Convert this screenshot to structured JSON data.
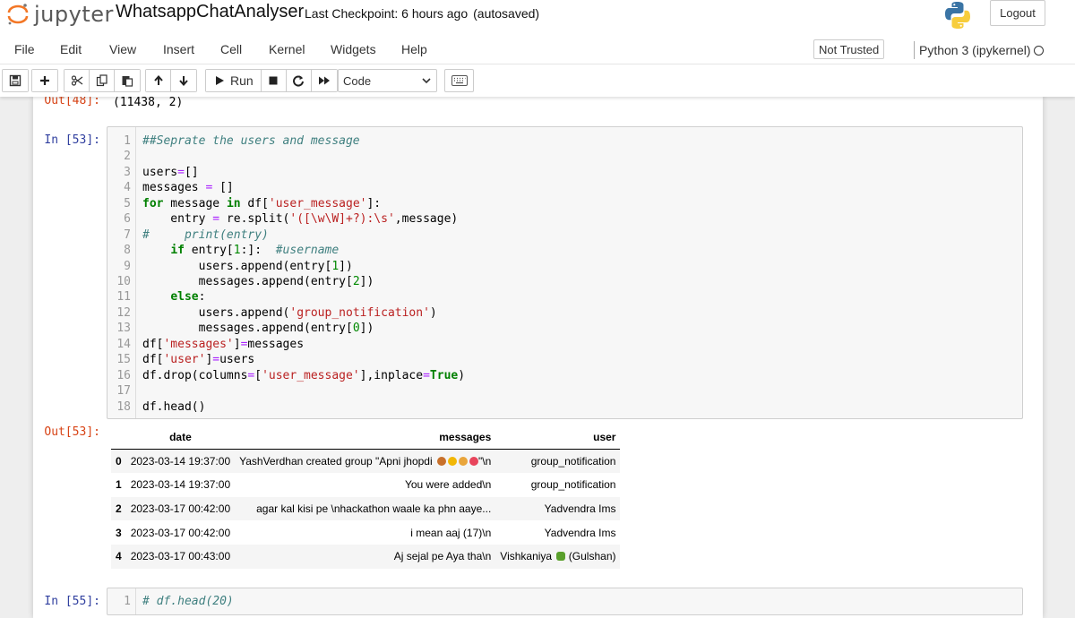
{
  "header": {
    "logo_text": "jupyter",
    "notebook_title": "WhatsappChatAnalyser",
    "checkpoint": "Last Checkpoint: 6 hours ago",
    "autosaved": "(autosaved)",
    "logout_label": "Logout"
  },
  "menubar": {
    "items": [
      "File",
      "Edit",
      "View",
      "Insert",
      "Cell",
      "Kernel",
      "Widgets",
      "Help"
    ],
    "trust_status": "Not Trusted",
    "kernel_name": "Python 3 (ipykernel)"
  },
  "toolbar": {
    "run_label": "Run",
    "cell_type": "Code"
  },
  "cells": [
    {
      "out_prompt": "Out[48]:",
      "output_text": "(11438, 2)"
    },
    {
      "in_prompt": "In [53]:",
      "line_numbers": [
        "1",
        "2",
        "3",
        "4",
        "5",
        "6",
        "7",
        "8",
        "9",
        "10",
        "11",
        "12",
        "13",
        "14",
        "15",
        "16",
        "17",
        "18"
      ],
      "out_prompt": "Out[53]:",
      "dataframe": {
        "columns": [
          "date",
          "messages",
          "user"
        ],
        "rows": [
          {
            "index": "0",
            "date": "2023-03-14 19:37:00",
            "messages": "YashVerdhan created group \"Apni jhopdi",
            "messages_tail": "\"\\n",
            "user": "group_notification"
          },
          {
            "index": "1",
            "date": "2023-03-14 19:37:00",
            "messages": "You were added\\n",
            "messages_tail": "",
            "user": "group_notification"
          },
          {
            "index": "2",
            "date": "2023-03-17 00:42:00",
            "messages": "agar kal kisi pe \\nhackathon waale ka phn aaye...",
            "messages_tail": "",
            "user": "Yadvendra Ims"
          },
          {
            "index": "3",
            "date": "2023-03-17 00:42:00",
            "messages": "i mean aaj (17)\\n",
            "messages_tail": "",
            "user": "Yadvendra Ims"
          },
          {
            "index": "4",
            "date": "2023-03-17 00:43:00",
            "messages": "Aj sejal pe Aya tha\\n",
            "messages_tail": "",
            "user": "Vishkaniya",
            "user_tail": "(Gulshan)"
          }
        ]
      }
    },
    {
      "in_prompt": "In [55]:",
      "line_numbers": [
        "1"
      ],
      "code": "# df.head(20)"
    }
  ],
  "code_tokens": {
    "l1": "##Seprate the users and message",
    "l3a": "users",
    "l3b": "=",
    "l3c": "[]",
    "l4a": "messages ",
    "l4b": "=",
    "l4c": " []",
    "l5a": "for",
    "l5b": " message ",
    "l5c": "in",
    "l5d": " df[",
    "l5e": "'user_message'",
    "l5f": "]:",
    "l6a": "    entry ",
    "l6b": "=",
    "l6c": " re.split(",
    "l6d": "'([\\w\\W]+?):\\s'",
    "l6e": ",message)",
    "l7a": "#     print(entry)",
    "l8a": "    ",
    "l8b": "if",
    "l8c": " entry[",
    "l8d": "1",
    "l8e": ":]:  ",
    "l8f": "#username",
    "l9a": "        users.append(entry[",
    "l9b": "1",
    "l9c": "])",
    "l10a": "        messages.append(entry[",
    "l10b": "2",
    "l10c": "])",
    "l11a": "    ",
    "l11b": "else",
    "l11c": ":",
    "l12a": "        users.append(",
    "l12b": "'group_notification'",
    "l12c": ")",
    "l13a": "        messages.append(entry[",
    "l13b": "0",
    "l13c": "])",
    "l14a": "df[",
    "l14b": "'messages'",
    "l14c": "]",
    "l14d": "=",
    "l14e": "messages",
    "l15a": "df[",
    "l15b": "'user'",
    "l15c": "]",
    "l15d": "=",
    "l15e": "users",
    "l16a": "df.drop(columns",
    "l16b": "=",
    "l16c": "[",
    "l16d": "'user_message'",
    "l16e": "],inplace",
    "l16f": "=",
    "l16g": "True",
    "l16h": ")",
    "l18a": "df.head()"
  },
  "colors": {
    "in_prompt": "#303f9f",
    "out_prompt": "#d84315",
    "keyword": "#008000",
    "string": "#ba2121",
    "comment": "#408080",
    "operator": "#aa22ff"
  }
}
